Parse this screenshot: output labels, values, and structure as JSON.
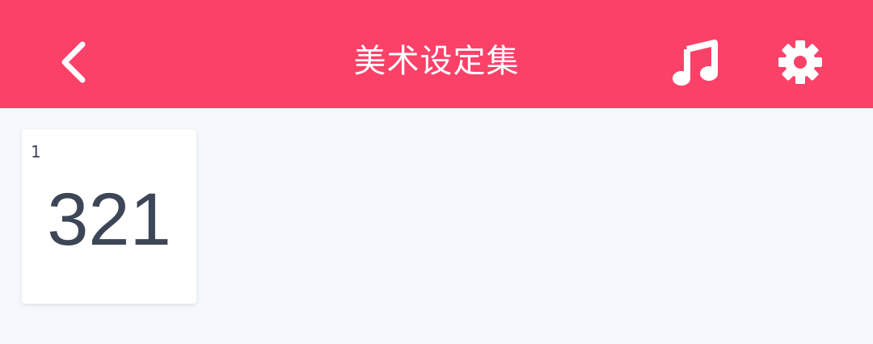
{
  "header": {
    "title": "美术设定集",
    "background_color": "#fc4169",
    "icons": {
      "back": "chevron-left-icon",
      "music": "music-note-icon",
      "settings": "gear-icon"
    }
  },
  "content": {
    "background_color": "#f5f9fd",
    "cards": [
      {
        "index": "1",
        "value": "321"
      }
    ]
  }
}
